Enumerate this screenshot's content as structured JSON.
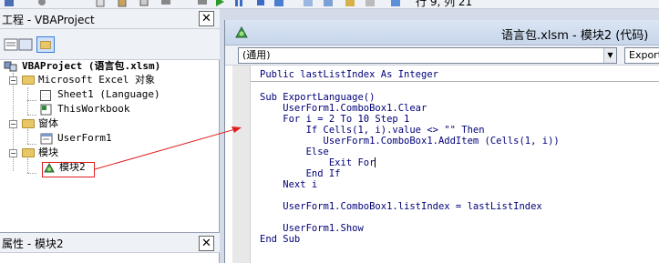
{
  "toolbar": {
    "status": "行 9, 列 21",
    "icons": [
      "vba-icon",
      "cut-icon",
      "copy-icon",
      "paste-icon",
      "find-icon",
      "undo-icon",
      "redo-icon",
      "run-icon",
      "break-icon",
      "reset-icon",
      "design-mode-icon",
      "project-explorer-icon",
      "properties-icon",
      "object-browser-icon",
      "toolbox-icon",
      "help-icon"
    ]
  },
  "project_pane": {
    "title": "工程 - VBAProject",
    "close": "✕",
    "tree": {
      "root": "VBAProject (语言包.xlsm)",
      "excel_objects_folder": "Microsoft Excel 对象",
      "sheet1": "Sheet1 (Language)",
      "this_workbook": "ThisWorkbook",
      "forms_folder": "窗体",
      "userform1": "UserForm1",
      "modules_folder": "模块",
      "module2": "模块2"
    }
  },
  "props_pane": {
    "title": "属性 - 模块2",
    "close": "✕"
  },
  "code_window": {
    "title": "语言包.xlsm - 模块2 (代码)",
    "object_combo": "(通用)",
    "proc_combo": "ExportLanguage",
    "lines": [
      "Public lastListIndex As Integer",
      "",
      "Sub ExportLanguage()",
      "    UserForm1.ComboBox1.Clear",
      "    For i = 2 To 10 Step 1",
      "        If Cells(1, i).value <> \"\" Then",
      "           UserForm1.ComboBox1.AddItem (Cells(1, i))",
      "        Else",
      "            Exit For",
      "        End If",
      "    Next i",
      "",
      "    UserForm1.ComboBox1.listIndex = lastListIndex",
      "",
      "    UserForm1.Show",
      "End Sub"
    ]
  },
  "colors": {
    "code_text": "#00007a",
    "annotation_red": "#e02020"
  }
}
